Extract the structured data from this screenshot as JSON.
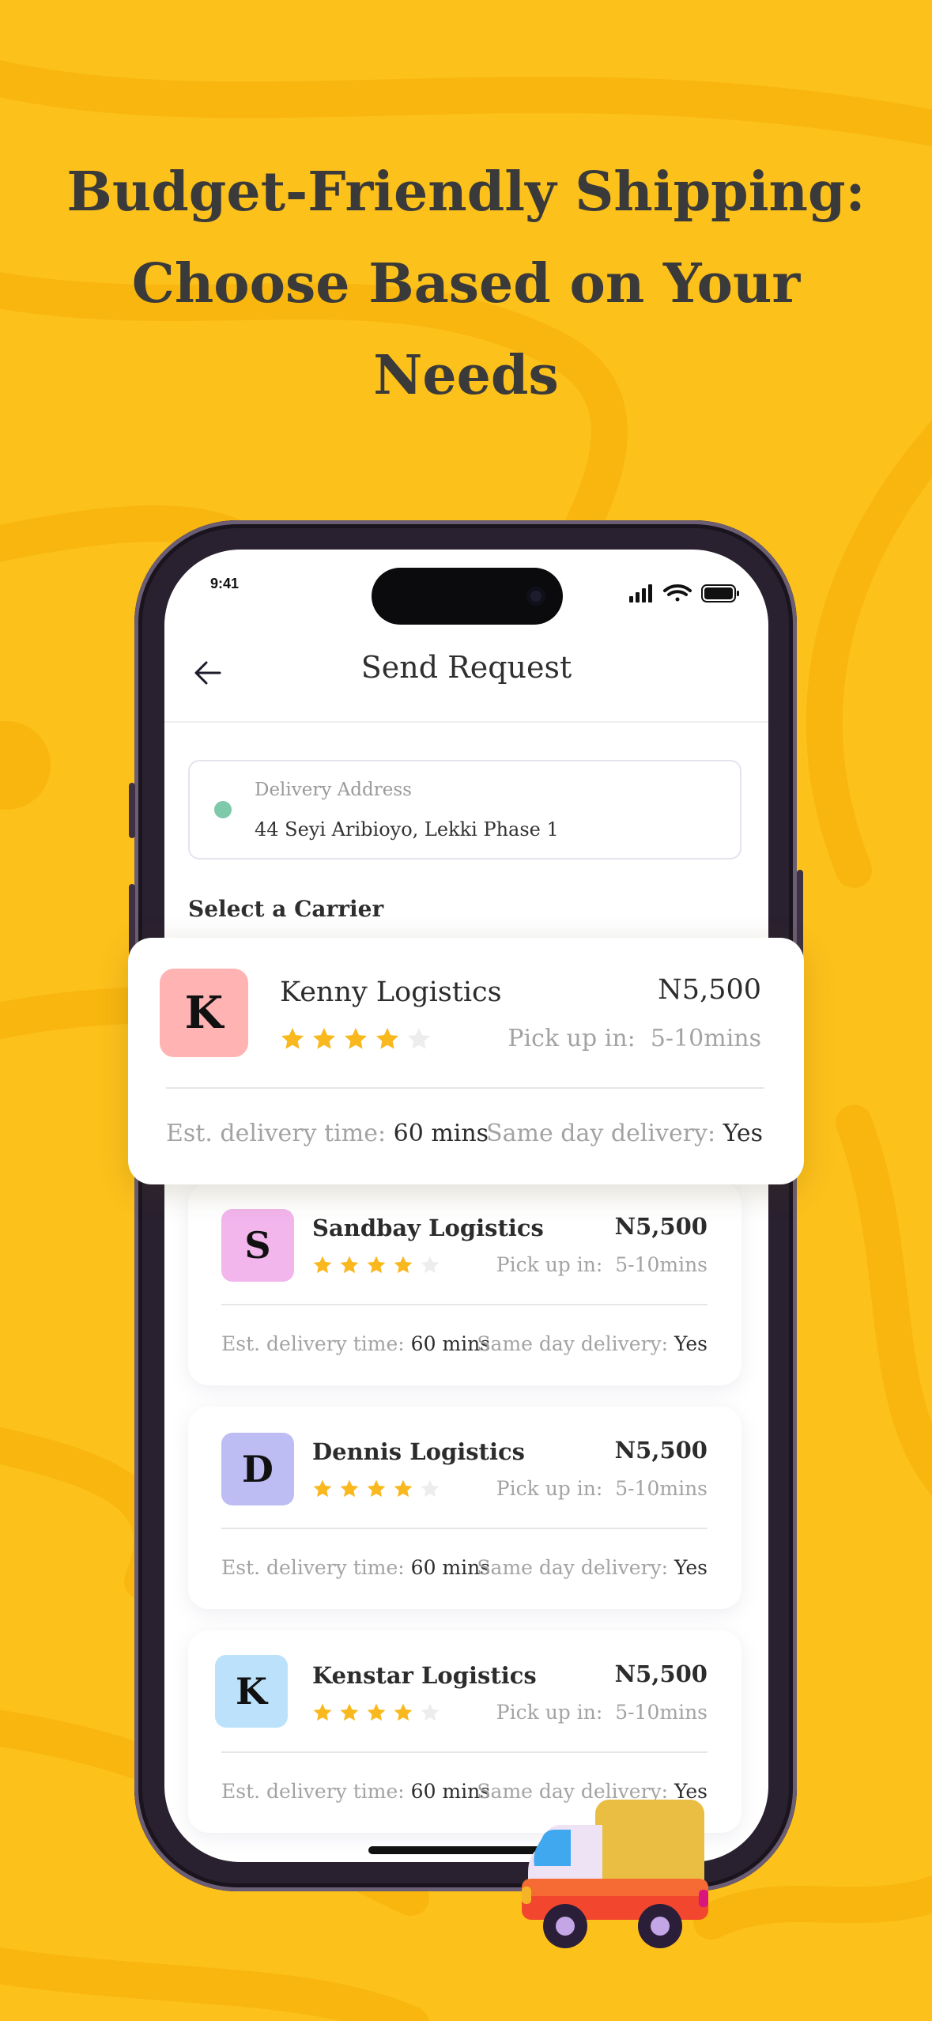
{
  "colors": {
    "background": "#FDC11C",
    "headline": "#3a3a3a",
    "star_filled": "#F9B81E",
    "star_empty": "#EDEDED"
  },
  "headline": {
    "lines": [
      "Budget-Friendly Shipping:",
      "Choose Based on Your",
      "Needs"
    ]
  },
  "status_bar": {
    "time": "9:41",
    "icons": [
      "signal-icon",
      "wifi-icon",
      "battery-icon"
    ]
  },
  "nav": {
    "back_icon": "arrow-left-icon",
    "title": "Send Request"
  },
  "delivery": {
    "label": "Delivery Address",
    "value": "44 Seyi Aribioyo, Lekki Phase 1"
  },
  "section_title": "Select a Carrier",
  "carriers": [
    {
      "initial": "K",
      "name": "Kenny Logistics",
      "price": "N5,500",
      "pickup_label": "Pick up in:",
      "pickup_value": "5-10mins",
      "rating": 4,
      "rating_max": 5,
      "eta_label": "Est. delivery time:",
      "eta_value": "60 mins",
      "same_day_label": "Same day delivery:",
      "same_day_value": "Yes",
      "logo_color": "#FFB3B3"
    },
    {
      "initial": "S",
      "name": "Sandbay Logistics",
      "price": "N5,500",
      "pickup_label": "Pick up in:",
      "pickup_value": "5-10mins",
      "rating": 4,
      "rating_max": 5,
      "eta_label": "Est. delivery time:",
      "eta_value": "60 mins",
      "same_day_label": "Same day delivery:",
      "same_day_value": "Yes",
      "logo_color": "#F2B5EC"
    },
    {
      "initial": "D",
      "name": "Dennis Logistics",
      "price": "N5,500",
      "pickup_label": "Pick up in:",
      "pickup_value": "5-10mins",
      "rating": 4,
      "rating_max": 5,
      "eta_label": "Est. delivery time:",
      "eta_value": "60 mins",
      "same_day_label": "Same day delivery:",
      "same_day_value": "Yes",
      "logo_color": "#BDBDF4"
    },
    {
      "initial": "K",
      "name": "Kenstar Logistics",
      "price": "N5,500",
      "pickup_label": "Pick up in:",
      "pickup_value": "5-10mins",
      "rating": 4,
      "rating_max": 5,
      "eta_label": "Est. delivery time:",
      "eta_value": "60 mins",
      "same_day_label": "Same day delivery:",
      "same_day_value": "Yes",
      "logo_color": "#BCE2FB"
    }
  ],
  "decoration": {
    "truck_icon": "delivery-truck-icon"
  }
}
